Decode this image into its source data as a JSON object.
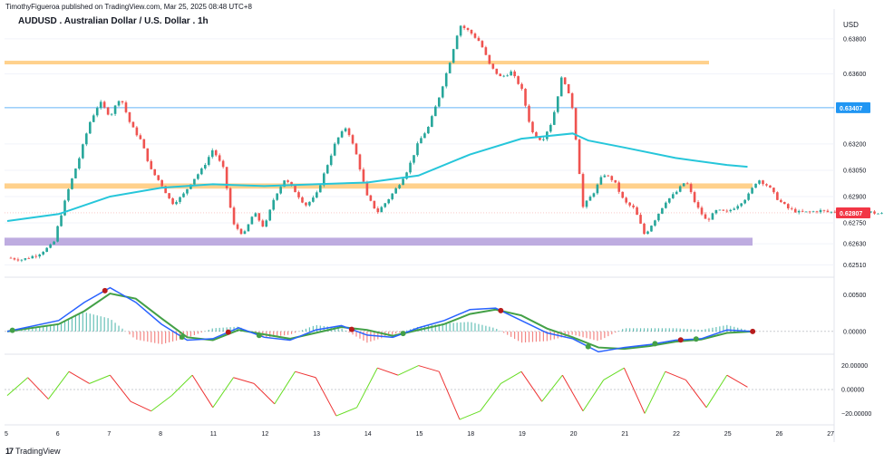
{
  "header": {
    "publisher": "TimothyFigueroa published on TradingView.com, Mar 25, 2025 08:48 UTC+8",
    "title": "AUDUSD . Australian Dollar / U.S. Dollar . 1h",
    "currency": "USD"
  },
  "footer": {
    "logo_text": "TradingView",
    "logo_mark": "17"
  },
  "colors": {
    "bull": "#26a69a",
    "bear": "#ef5350",
    "ma": "#26c6da",
    "resistance_zone": "#ffcc80",
    "support_zone": "#b39ddb",
    "hline": "#64b5f6",
    "macd_line": "#2962ff",
    "signal_line": "#43a047",
    "rsi_up": "#66dd22",
    "rsi_down": "#ee3333"
  },
  "chart_data": [
    {
      "type": "line",
      "panel": "price",
      "title": "AUDUSD . Australian Dollar / U.S. Dollar . 1h",
      "y_ticks": [
        "0.63800",
        "0.63600",
        "0.63200",
        "0.63050",
        "0.62900",
        "0.62750",
        "0.62630",
        "0.62510"
      ],
      "y_range": [
        0.6245,
        0.6397
      ],
      "x_ticks": [
        "5",
        "6",
        "7",
        "8",
        "11",
        "12",
        "13",
        "14",
        "15",
        "18",
        "19",
        "20",
        "21",
        "22",
        "25",
        "26",
        "27"
      ],
      "price_labels": [
        {
          "text": "0.63407",
          "value": 0.63407,
          "color": "#2196f3"
        },
        {
          "text": "0.62807",
          "value": 0.62807,
          "color": "#f23645"
        }
      ],
      "zones": [
        {
          "name": "resistance-upper",
          "from": 0.63655,
          "to": 0.63675,
          "color": "#ffcc80"
        },
        {
          "name": "resistance-lower",
          "from": 0.62945,
          "to": 0.62975,
          "color": "#ffcc80"
        },
        {
          "name": "support",
          "from": 0.6262,
          "to": 0.62665,
          "color": "#b39ddb"
        }
      ],
      "series": [
        {
          "kind": "price",
          "x": [
            0,
            0.3,
            0.6,
            0.9,
            1.0,
            1.2,
            1.4,
            1.6,
            1.8,
            2.0,
            2.2,
            2.4,
            2.6,
            2.8,
            3.0,
            3.2,
            3.4,
            3.6,
            3.8,
            4.0,
            4.2,
            4.4,
            4.6,
            4.8,
            5.0,
            5.2,
            5.4,
            5.6,
            5.8,
            6.0,
            6.2,
            6.4,
            6.6,
            6.8,
            7.0,
            7.2,
            7.4,
            7.6,
            7.8,
            8.0,
            8.2,
            8.4,
            8.6,
            8.8,
            9.0,
            9.2,
            9.4,
            9.6,
            9.8,
            10.0,
            10.2,
            10.4,
            10.6,
            10.8,
            11.0,
            11.2,
            11.4,
            11.6,
            11.8,
            12.0,
            12.2,
            12.4,
            12.6,
            12.8,
            13.0,
            13.2,
            13.4,
            13.6,
            13.8,
            14.0,
            14.2,
            14.4,
            14.6,
            14.8,
            15.0,
            15.2,
            15.4,
            15.6,
            15.8,
            16.0,
            16.2,
            16.4,
            16.6,
            16.8,
            17.0,
            17.2,
            17.4,
            17.6,
            17.8,
            18.0
          ],
          "y": [
            0.6255,
            0.6254,
            0.6257,
            0.6263,
            0.6275,
            0.6295,
            0.6312,
            0.6332,
            0.6344,
            0.6336,
            0.6347,
            0.6331,
            0.6322,
            0.6305,
            0.6297,
            0.6286,
            0.629,
            0.6299,
            0.6306,
            0.6317,
            0.6306,
            0.6274,
            0.6268,
            0.6281,
            0.6272,
            0.629,
            0.63,
            0.6293,
            0.6285,
            0.629,
            0.6306,
            0.6322,
            0.633,
            0.6313,
            0.629,
            0.6281,
            0.6288,
            0.6296,
            0.6306,
            0.6321,
            0.633,
            0.6347,
            0.6366,
            0.6388,
            0.6384,
            0.6378,
            0.6364,
            0.6358,
            0.6361,
            0.6352,
            0.6327,
            0.6322,
            0.6333,
            0.636,
            0.634,
            0.6284,
            0.6292,
            0.6303,
            0.6299,
            0.6287,
            0.6283,
            0.6268,
            0.6277,
            0.6287,
            0.6292,
            0.6299,
            0.6285,
            0.6276,
            0.6282,
            0.6281,
            0.6285,
            0.629,
            0.63,
            0.6296,
            0.6288,
            0.6283,
            0.6281,
            0.6281,
            0.6282,
            0.6281,
            0.6282,
            0.6282,
            0.6281,
            0.6281,
            0.628,
            0.6281,
            0.628,
            0.6281,
            0.6281,
            0.62807
          ]
        },
        {
          "kind": "moving-average",
          "x": [
            0,
            1,
            2,
            3,
            4,
            5,
            6,
            7,
            8,
            9,
            10,
            11,
            11.3,
            12,
            13,
            14,
            14.4
          ],
          "y": [
            0.6276,
            0.628,
            0.629,
            0.6295,
            0.6297,
            0.6296,
            0.6297,
            0.6298,
            0.6302,
            0.6314,
            0.6323,
            0.6326,
            0.6322,
            0.6318,
            0.6312,
            0.6308,
            0.6307
          ]
        }
      ]
    },
    {
      "type": "line",
      "panel": "macd",
      "y_ticks": [
        "0.00500",
        "0.00000"
      ],
      "y_range": [
        -0.003,
        0.0072
      ],
      "series": [
        {
          "name": "macd",
          "x": [
            0,
            1,
            1.5,
            2,
            2.5,
            3,
            3.5,
            4,
            4.5,
            5,
            5.5,
            6,
            6.5,
            7,
            7.5,
            8,
            8.5,
            9,
            9.5,
            10,
            10.5,
            11,
            11.5,
            12,
            12.5,
            13,
            13.5,
            14,
            14.5
          ],
          "y": [
            0,
            0.0015,
            0.004,
            0.006,
            0.004,
            0.001,
            -0.0012,
            -0.001,
            0.0005,
            -0.0008,
            -0.0012,
            0.0002,
            0.0008,
            -0.0005,
            -0.0008,
            0.0005,
            0.0015,
            0.003,
            0.0032,
            0.0015,
            -0.0002,
            -0.001,
            -0.0028,
            -0.0022,
            -0.0018,
            -0.0012,
            -0.001,
            0.0002,
            0.0
          ]
        },
        {
          "name": "signal",
          "x": [
            0,
            1,
            1.5,
            2,
            2.5,
            3,
            3.5,
            4,
            4.5,
            5,
            5.5,
            6,
            6.5,
            7,
            7.5,
            8,
            8.5,
            9,
            9.5,
            10,
            10.5,
            11,
            11.5,
            12,
            12.5,
            13,
            13.5,
            14,
            14.5
          ],
          "y": [
            0,
            0.001,
            0.0028,
            0.0052,
            0.0045,
            0.0018,
            -0.0008,
            -0.0012,
            0.0002,
            -0.0004,
            -0.001,
            -0.0002,
            0.0006,
            0.0002,
            -0.0006,
            0.0002,
            0.001,
            0.0024,
            0.003,
            0.0022,
            0.0004,
            -0.0008,
            -0.0022,
            -0.0024,
            -0.002,
            -0.0014,
            -0.0011,
            -0.0002,
            0.0
          ]
        }
      ],
      "cross_markers": [
        {
          "x": 0.1,
          "color": "green"
        },
        {
          "x": 1.9,
          "color": "red"
        },
        {
          "x": 3.4,
          "color": "green"
        },
        {
          "x": 4.3,
          "color": "red"
        },
        {
          "x": 4.9,
          "color": "green"
        },
        {
          "x": 6.7,
          "color": "red"
        },
        {
          "x": 7.7,
          "color": "green"
        },
        {
          "x": 9.6,
          "color": "red"
        },
        {
          "x": 11.3,
          "color": "green"
        },
        {
          "x": 12.6,
          "color": "green"
        },
        {
          "x": 13.1,
          "color": "red"
        },
        {
          "x": 13.4,
          "color": "green"
        },
        {
          "x": 14.5,
          "color": "red"
        }
      ]
    },
    {
      "type": "line",
      "panel": "oscillator",
      "y_ticks": [
        "20.00000",
        "0.00000",
        "−20.00000"
      ],
      "y_range": [
        -28,
        28
      ],
      "series": [
        {
          "name": "oscillator",
          "x": [
            0,
            0.4,
            0.8,
            1.2,
            1.6,
            2.0,
            2.4,
            2.8,
            3.2,
            3.6,
            4.0,
            4.4,
            4.8,
            5.2,
            5.6,
            6.0,
            6.4,
            6.8,
            7.2,
            7.6,
            8.0,
            8.4,
            8.8,
            9.2,
            9.6,
            10.0,
            10.4,
            10.8,
            11.2,
            11.6,
            12.0,
            12.4,
            12.8,
            13.2,
            13.6,
            14.0,
            14.4
          ],
          "y": [
            -5,
            10,
            -8,
            15,
            5,
            12,
            -10,
            -18,
            -5,
            12,
            -15,
            10,
            5,
            -12,
            15,
            10,
            -22,
            -15,
            18,
            12,
            20,
            15,
            -25,
            -18,
            5,
            15,
            -10,
            12,
            -18,
            8,
            18,
            -20,
            15,
            8,
            -15,
            12,
            2
          ]
        }
      ]
    }
  ]
}
